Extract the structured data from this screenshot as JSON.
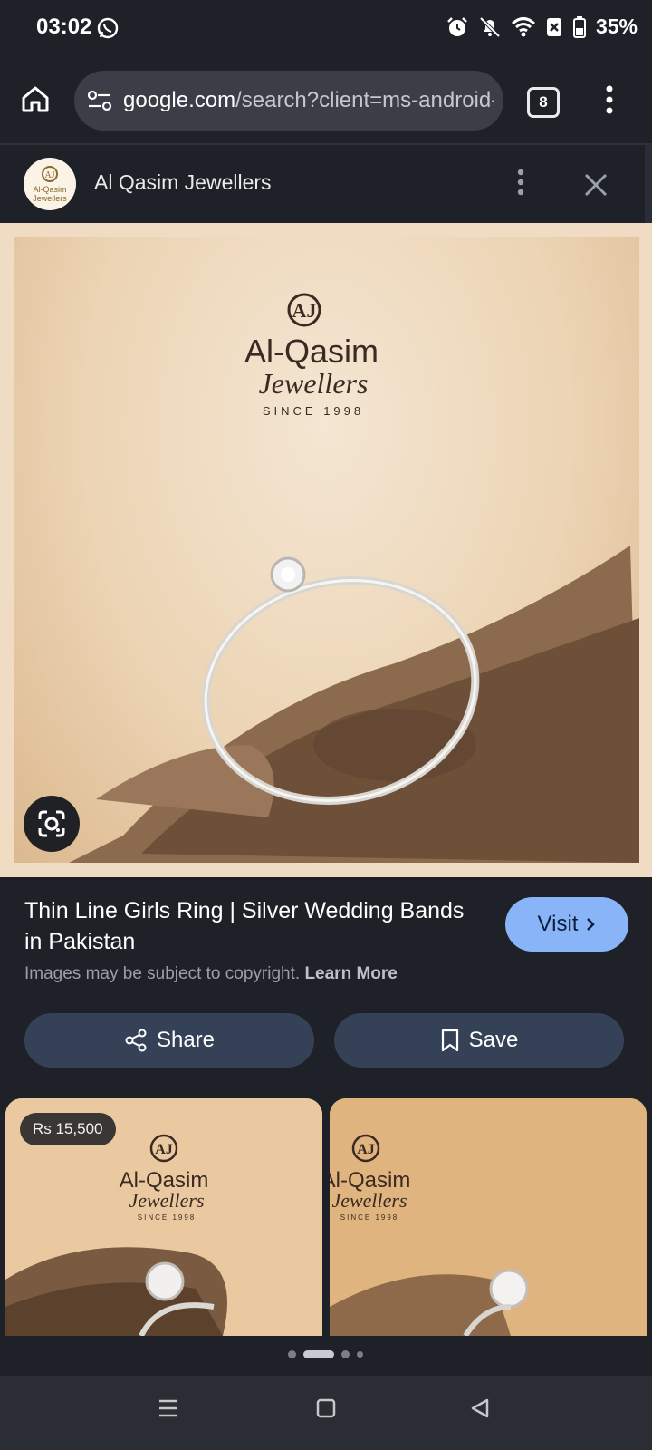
{
  "status_bar": {
    "time": "03:02",
    "battery": "35%",
    "icons": [
      "whatsapp-icon",
      "alarm-icon",
      "notifications-off-icon",
      "wifi-icon",
      "battery-icon"
    ]
  },
  "browser": {
    "url_domain": "google.com",
    "url_path": "/search?client=ms-android-",
    "tab_count": "8"
  },
  "site": {
    "name": "Al Qasim Jewellers",
    "logo_text_1": "Al-Qasim",
    "logo_text_2": "Jewellers"
  },
  "hero": {
    "logo_monogram": "AJ",
    "logo_line1": "Al-Qasim",
    "logo_line2": "Jewellers",
    "logo_line3": "SINCE 1998"
  },
  "result": {
    "title": "Thin Line Girls Ring | Silver Wedding Bands in Pakistan",
    "visit_label": "Visit",
    "copyright": "Images may be subject to copyright.",
    "learn_more": "Learn More"
  },
  "actions": {
    "share_label": "Share",
    "save_label": "Save"
  },
  "related": [
    {
      "price": "Rs 15,500",
      "logo_line1": "Al-Qasim",
      "logo_line2": "Jewellers",
      "logo_line3": "SINCE 1998"
    },
    {
      "logo_line1": "Al-Qasim",
      "logo_line2": "Jewellers",
      "logo_line3": "SINCE 1998"
    }
  ],
  "pager": {
    "count": 4,
    "active": 1
  },
  "colors": {
    "background": "#1f2128",
    "accent": "#8ab4f8",
    "button": "#354157"
  }
}
